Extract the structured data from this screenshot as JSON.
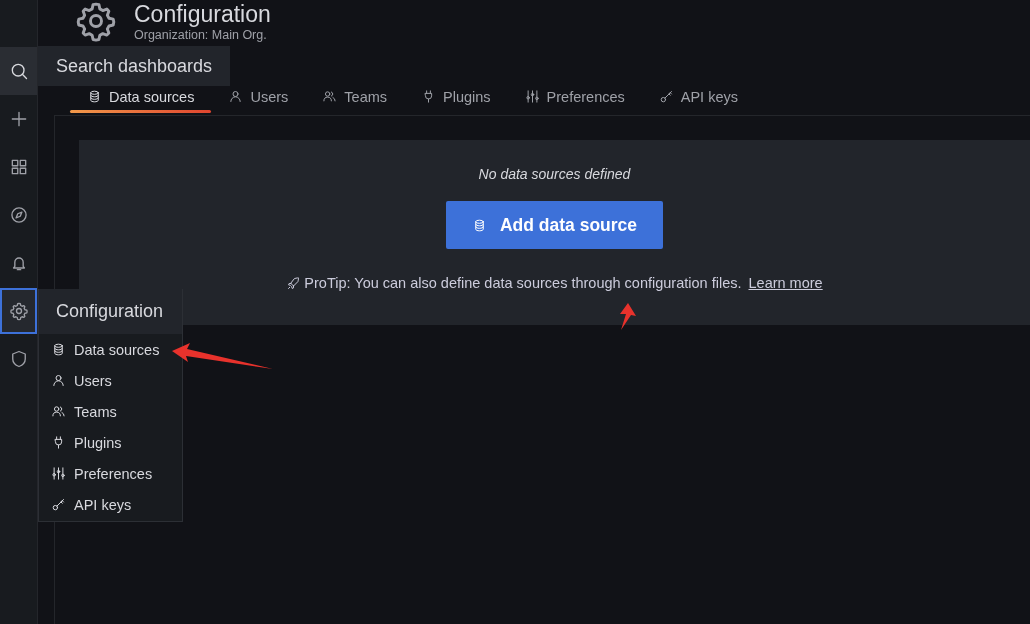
{
  "sidebar": {
    "items": [
      {
        "kind": "search",
        "selected": false,
        "highlighted": true
      },
      {
        "kind": "plus",
        "selected": false,
        "highlighted": false
      },
      {
        "kind": "apps",
        "selected": false,
        "highlighted": false
      },
      {
        "kind": "compass",
        "selected": false,
        "highlighted": false
      },
      {
        "kind": "bell",
        "selected": false,
        "highlighted": false
      },
      {
        "kind": "gear",
        "selected": true,
        "highlighted": false
      },
      {
        "kind": "shield",
        "selected": false,
        "highlighted": false
      }
    ]
  },
  "tooltip": {
    "text": "Search dashboards"
  },
  "header": {
    "title": "Configuration",
    "subtitle": "Organization: Main Org."
  },
  "tabs": [
    {
      "label": "Data sources",
      "kind": "database",
      "selected": true
    },
    {
      "label": "Users",
      "kind": "user",
      "selected": false
    },
    {
      "label": "Teams",
      "kind": "users",
      "selected": false
    },
    {
      "label": "Plugins",
      "kind": "plug",
      "selected": false
    },
    {
      "label": "Preferences",
      "kind": "sliders",
      "selected": false
    },
    {
      "label": "API keys",
      "kind": "key",
      "selected": false
    }
  ],
  "empty_state": {
    "message": "No data sources defined",
    "button": "Add data source",
    "protip": "ProTip: You can also define data sources through configuration files.",
    "link": "Learn more"
  },
  "menu": {
    "title": "Configuration",
    "items": [
      {
        "label": "Data sources",
        "kind": "database"
      },
      {
        "label": "Users",
        "kind": "user"
      },
      {
        "label": "Teams",
        "kind": "users"
      },
      {
        "label": "Plugins",
        "kind": "plug"
      },
      {
        "label": "Preferences",
        "kind": "sliders"
      },
      {
        "label": "API keys",
        "kind": "key"
      }
    ]
  },
  "annotations": [
    {
      "kind": "arrow"
    },
    {
      "kind": "arrow"
    }
  ]
}
